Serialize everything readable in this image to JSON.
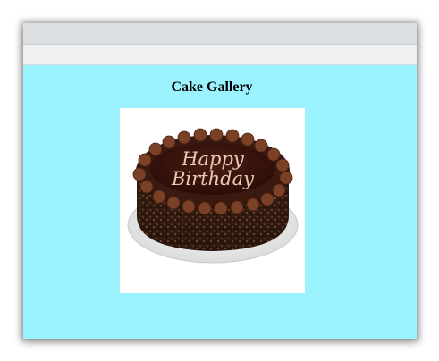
{
  "page": {
    "heading": "Cake Gallery"
  },
  "gallery": {
    "image_subject": "chocolate birthday cake",
    "cake_inscription_line1": "Happy",
    "cake_inscription_line2": "Birthday"
  },
  "colors": {
    "page_background": "#9af3ff",
    "toolbar": "#dde0e3",
    "subbar": "#eef0f1"
  }
}
